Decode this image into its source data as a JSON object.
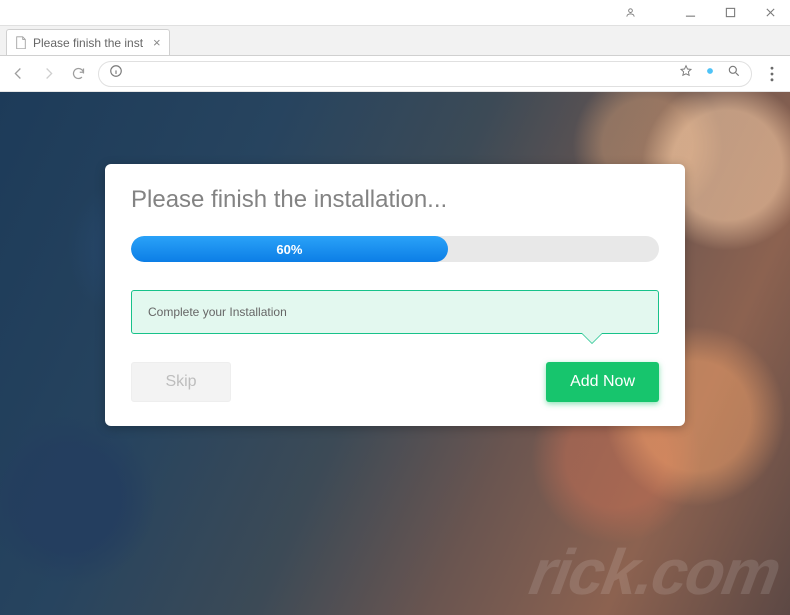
{
  "browser": {
    "tab_title": "Please finish the installati..."
  },
  "dialog": {
    "title": "Please finish the installation...",
    "progress_percent": 60,
    "progress_label": "60%",
    "tooltip": "Complete your Installation",
    "skip_label": "Skip",
    "add_label": "Add Now"
  },
  "colors": {
    "accent_green": "#17c56d",
    "progress_blue": "#0c7ee6",
    "tooltip_border": "#17c28a",
    "tooltip_bg": "#e3f8ef"
  },
  "watermark": "rick.com"
}
